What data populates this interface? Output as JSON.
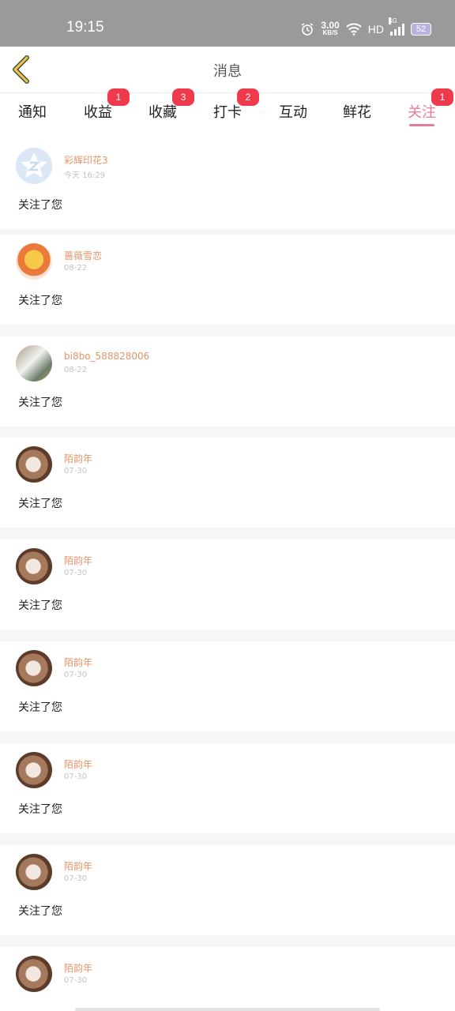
{
  "status_bar": {
    "time": "19:15",
    "net_speed": "3.00",
    "net_unit": "KB/S",
    "hd": "HD",
    "signal_type": "4G",
    "battery": "52"
  },
  "header": {
    "title": "消息"
  },
  "tabs": [
    {
      "label": "通知",
      "badge": ""
    },
    {
      "label": "收益",
      "badge": "1"
    },
    {
      "label": "收藏",
      "badge": "3"
    },
    {
      "label": "打卡",
      "badge": "2"
    },
    {
      "label": "互动",
      "badge": ""
    },
    {
      "label": "鲜花",
      "badge": ""
    },
    {
      "label": "关注",
      "badge": "1",
      "active": true
    }
  ],
  "messages": [
    {
      "name": "彩辉印花3",
      "date": "今天 16:29",
      "text": "关注了您",
      "avatar": "default-avatar"
    },
    {
      "name": "蔷薇雪恋",
      "date": "08-22",
      "text": "关注了您",
      "avatar": "anime-avatar"
    },
    {
      "name": "bi8bo_588828006",
      "date": "08-22",
      "text": "关注了您",
      "avatar": "photo-avatar"
    },
    {
      "name": "陌韵年",
      "date": "07-30",
      "text": "关注了您",
      "avatar": "girl-avatar"
    },
    {
      "name": "陌韵年",
      "date": "07-30",
      "text": "关注了您",
      "avatar": "girl-avatar"
    },
    {
      "name": "陌韵年",
      "date": "07-30",
      "text": "关注了您",
      "avatar": "girl-avatar"
    },
    {
      "name": "陌韵年",
      "date": "07-30",
      "text": "关注了您",
      "avatar": "girl-avatar"
    },
    {
      "name": "陌韵年",
      "date": "07-30",
      "text": "关注了您",
      "avatar": "girl-avatar"
    },
    {
      "name": "陌韵年",
      "date": "07-30",
      "text": "",
      "avatar": "girl-avatar"
    }
  ],
  "colors": {
    "accent": "#e87aa0",
    "badge": "#ef3a4c",
    "username": "#e4956b",
    "back_arrow": "#e8c64a"
  }
}
